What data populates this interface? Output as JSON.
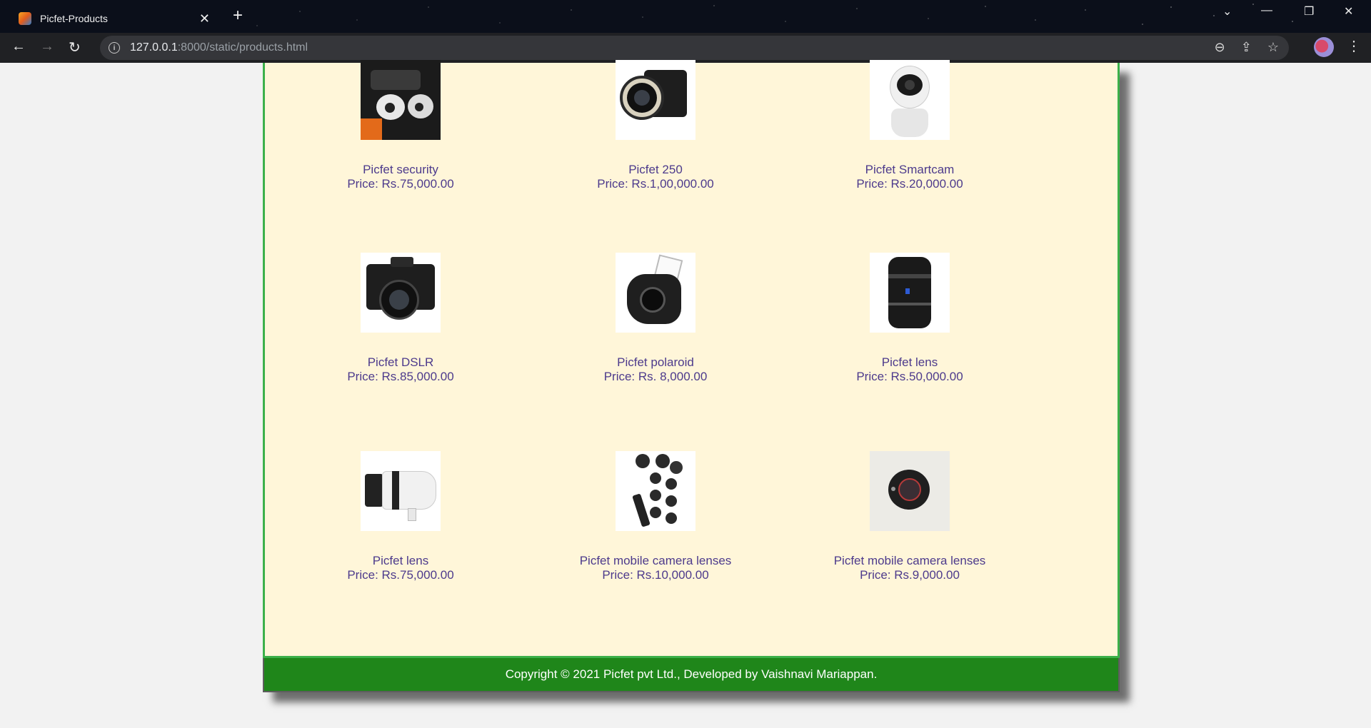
{
  "browser": {
    "tab_title": "Picfet-Products",
    "url_host": "127.0.0.1",
    "url_rest": ":8000/static/products.html"
  },
  "products": [
    {
      "name": "Picfet security",
      "price": "Price: Rs.75,000.00",
      "icon": "security-camera-icon"
    },
    {
      "name": "Picfet 250",
      "price": "Price: Rs.1,00,000.00",
      "icon": "dslr-camera-icon"
    },
    {
      "name": "Picfet Smartcam",
      "price": "Price: Rs.20,000.00",
      "icon": "smart-camera-icon"
    },
    {
      "name": "Picfet DSLR",
      "price": "Price: Rs.85,000.00",
      "icon": "dslr-camera-icon"
    },
    {
      "name": "Picfet polaroid",
      "price": "Price: Rs. 8,000.00",
      "icon": "instant-camera-icon"
    },
    {
      "name": "Picfet lens",
      "price": "Price: Rs.50,000.00",
      "icon": "camera-lens-icon"
    },
    {
      "name": "Picfet lens",
      "price": "Price: Rs.75,000.00",
      "icon": "telephoto-lens-icon"
    },
    {
      "name": "Picfet mobile camera lenses",
      "price": "Price: Rs.10,000.00",
      "icon": "mobile-lens-kit-icon"
    },
    {
      "name": "Picfet mobile camera lenses",
      "price": "Price: Rs.9,000.00",
      "icon": "mobile-lens-icon"
    }
  ],
  "footer": {
    "text": "Copyright © 2021 Picfet pvt Ltd., Developed by Vaishnavi Mariappan."
  }
}
